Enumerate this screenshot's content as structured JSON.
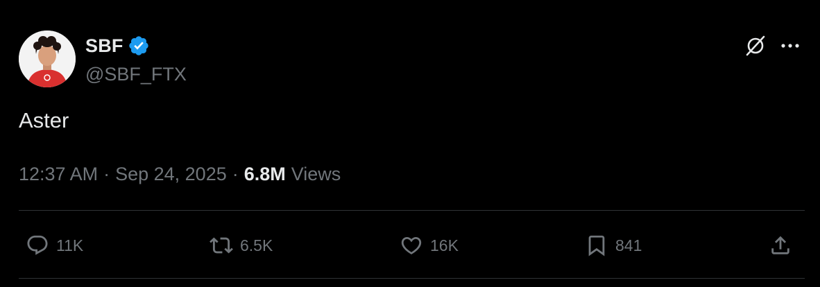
{
  "author": {
    "name": "SBF",
    "handle": "@SBF_FTX",
    "verified": true,
    "verified_color": "#1d9bf0"
  },
  "tweet": {
    "text": "Aster",
    "time": "12:37 AM",
    "separator": "·",
    "date": "Sep 24, 2025",
    "views_count": "6.8M",
    "views_label": "Views"
  },
  "actions": {
    "reply": {
      "icon": "reply-icon",
      "count": "11K"
    },
    "retweet": {
      "icon": "retweet-icon",
      "count": "6.5K"
    },
    "like": {
      "icon": "heart-icon",
      "count": "16K"
    },
    "bookmark": {
      "icon": "bookmark-icon",
      "count": "841"
    },
    "share": {
      "icon": "share-icon"
    }
  },
  "header_icons": [
    "grok-icon",
    "more-icon"
  ],
  "colors": {
    "background": "#000000",
    "text_primary": "#e7e9ea",
    "text_secondary": "#71767b",
    "divider": "#2f3336",
    "avatar_shirt": "#d9302f"
  }
}
